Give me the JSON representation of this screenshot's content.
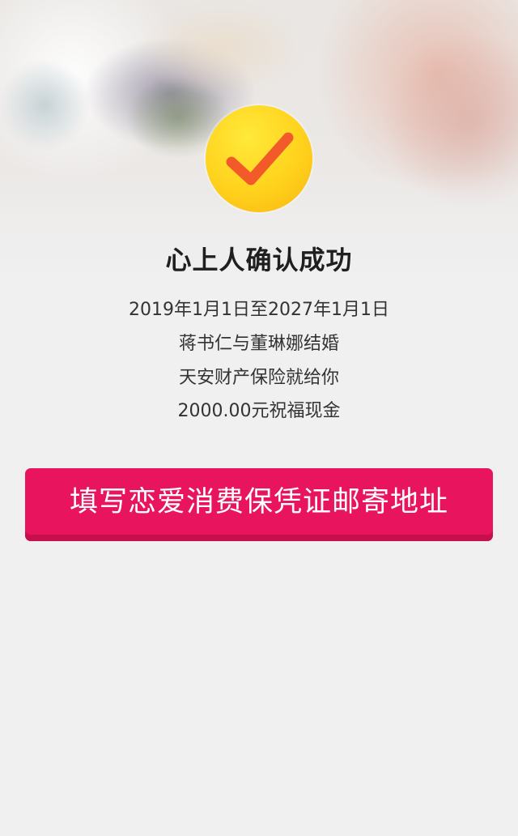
{
  "header": {
    "title": "心上人确认成功"
  },
  "details": {
    "period": "2019年1月1日至2027年1月1日",
    "couple": "蒋书仁与董琳娜结婚",
    "insurer": "天安财产保险就给你",
    "gift": "2000.00元祝福现金"
  },
  "actions": {
    "fill_address_label": "填写恋爱消费保凭证邮寄地址"
  },
  "icons": {
    "success": "checkmark-icon"
  },
  "colors": {
    "accent": "#e8155e",
    "badge": "#ffd21c",
    "check": "#f25a2a"
  }
}
